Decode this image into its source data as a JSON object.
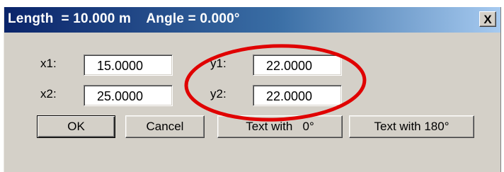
{
  "window": {
    "title": "Length  = 10.000 m    Angle = 0.000°",
    "close_label": "X"
  },
  "fields": {
    "x1": {
      "label": "x1:",
      "value": "15.0000"
    },
    "x2": {
      "label": "x2:",
      "value": "25.0000"
    },
    "y1": {
      "label": "y1:",
      "value": "22.0000"
    },
    "y2": {
      "label": "y2:",
      "value": "22.0000"
    }
  },
  "buttons": {
    "ok": "OK",
    "cancel": "Cancel",
    "text_0": "Text with   0°",
    "text_180": "Text with 180°"
  },
  "annotation": {
    "color": "#e00000"
  }
}
